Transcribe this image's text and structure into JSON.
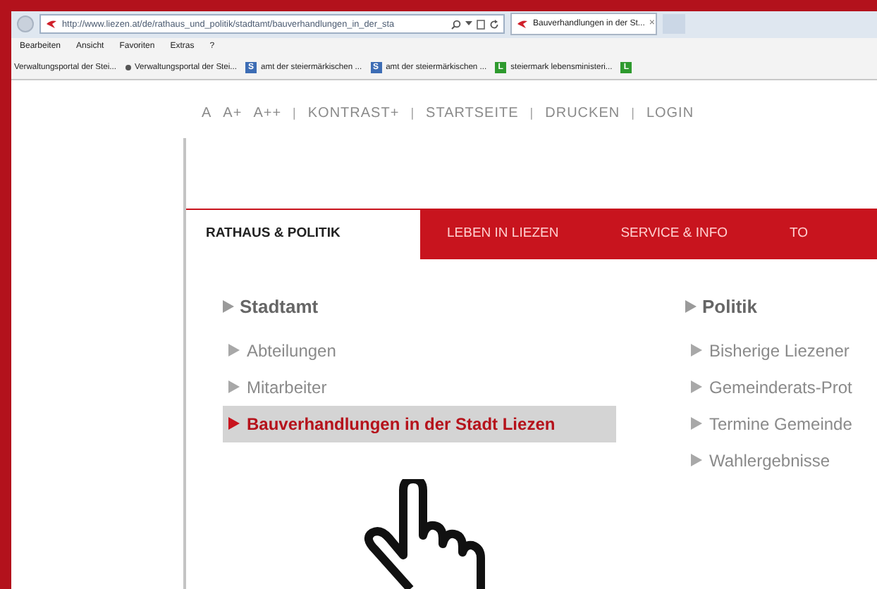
{
  "browser": {
    "url": "http://www.liezen.at/de/rathaus_und_politik/stadtamt/bauverhandlungen_in_der_sta",
    "tab_title": "Bauverhandlungen in der St...",
    "tab_close": "×",
    "menu": [
      "Bearbeiten",
      "Ansicht",
      "Favoriten",
      "Extras",
      "?"
    ],
    "favorites": [
      {
        "kind": "plain",
        "label": "Verwaltungsportal der Stei..."
      },
      {
        "kind": "dot",
        "label": "Verwaltungsportal der Stei..."
      },
      {
        "kind": "letter",
        "icon_text": "S",
        "color": "#3d6db5",
        "label": "amt der steiermärkischen ..."
      },
      {
        "kind": "letter",
        "icon_text": "S",
        "color": "#3d6db5",
        "label": "amt der steiermärkischen ..."
      },
      {
        "kind": "letter",
        "icon_text": "L",
        "color": "#2e9a2e",
        "label": "steiermark lebensministeri..."
      },
      {
        "kind": "letter",
        "icon_text": "L",
        "color": "#2e9a2e"
      }
    ]
  },
  "accessibility_links": [
    {
      "kind": "link",
      "label": "A"
    },
    {
      "kind": "link",
      "label": "A+"
    },
    {
      "kind": "link",
      "label": "A++"
    },
    {
      "kind": "separator",
      "label": "|"
    },
    {
      "kind": "link",
      "label": "KONTRAST+"
    },
    {
      "kind": "separator",
      "label": "|"
    },
    {
      "kind": "link",
      "label": "STARTSEITE"
    },
    {
      "kind": "separator",
      "label": "|"
    },
    {
      "kind": "link",
      "label": "DRUCKEN"
    },
    {
      "kind": "separator",
      "label": "|"
    },
    {
      "kind": "link",
      "label": "LOGIN"
    }
  ],
  "nav_tabs": [
    {
      "label": "RATHAUS & POLITIK",
      "selected": true
    },
    {
      "label": "LEBEN IN LIEZEN",
      "selected": false
    },
    {
      "label": "SERVICE & INFO",
      "selected": false
    },
    {
      "label": "TO",
      "selected": false
    }
  ],
  "menu_columns": [
    {
      "heading": "Stadtamt",
      "items": [
        {
          "label": "Abteilungen",
          "selected": false
        },
        {
          "label": "Mitarbeiter",
          "selected": false
        },
        {
          "label": "Bauverhandlungen in der Stadt Liezen",
          "selected": true
        }
      ]
    },
    {
      "heading": "Politik",
      "items": [
        {
          "label": "Bisherige Liezener",
          "selected": false
        },
        {
          "label": "Gemeinderats-Prot",
          "selected": false
        },
        {
          "label": "Termine Gemeinde",
          "selected": false
        },
        {
          "label": "Wahlergebnisse",
          "selected": false
        }
      ]
    }
  ]
}
